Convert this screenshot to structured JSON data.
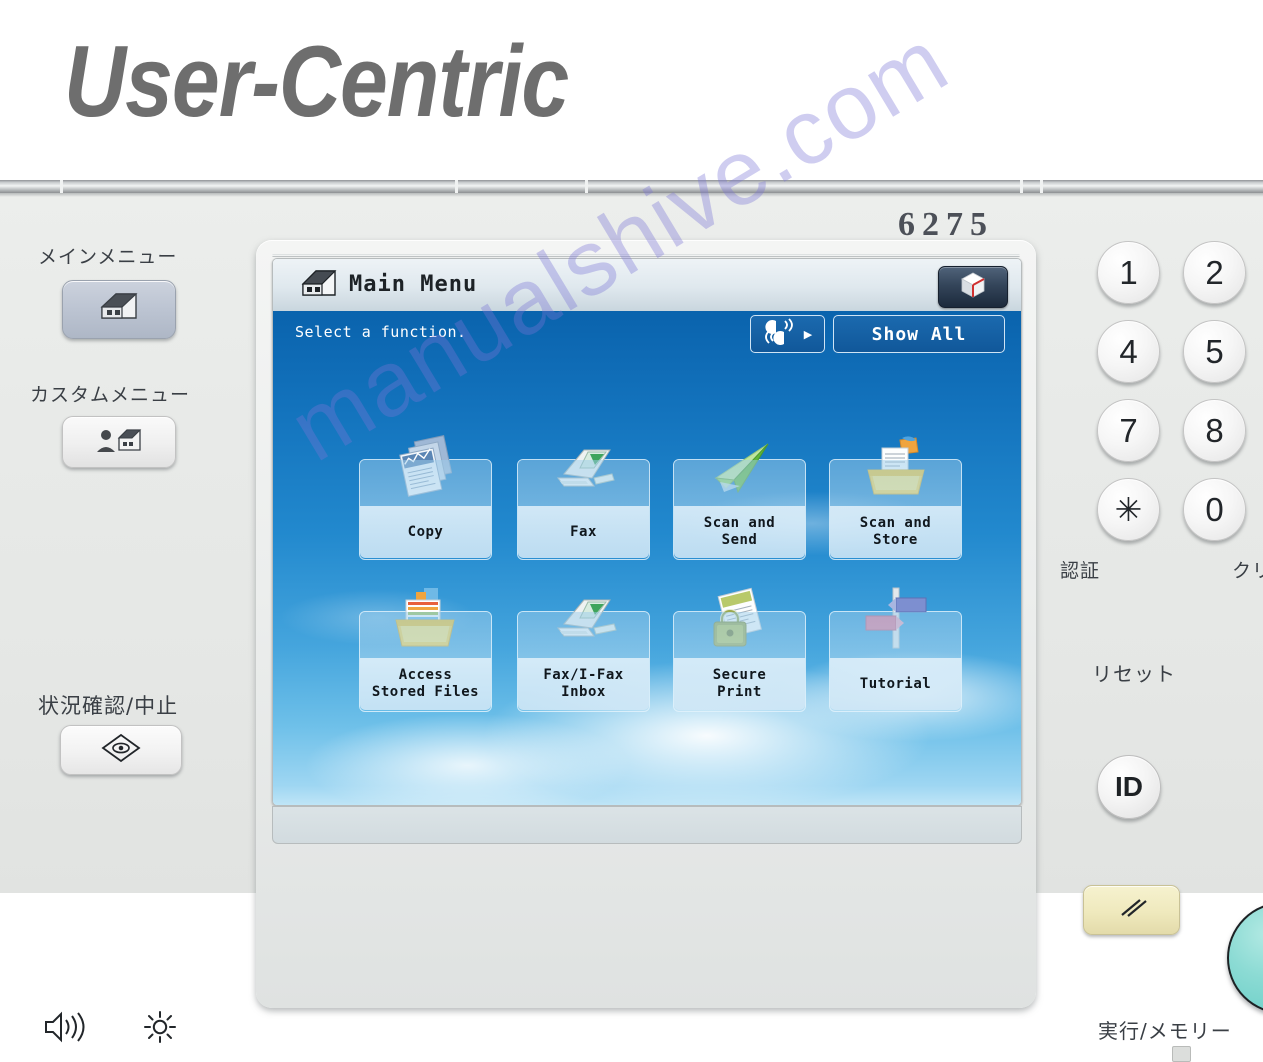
{
  "header": {
    "title": "User-Centric"
  },
  "panel": {
    "model_number": "6275",
    "left_controls": {
      "main_menu_label": "メインメニュー",
      "main_menu_icon": "house-icon",
      "custom_menu_label": "カスタムメニュー",
      "custom_menu_icon": "person-house-icon",
      "status_label": "状況確認/中止",
      "status_icon": "diamond-eye-icon",
      "speaker_icon": "speaker-volume-icon",
      "brightness_icon": "brightness-sun-icon"
    },
    "right_controls": {
      "keypad": [
        "1",
        "2",
        "4",
        "5",
        "7",
        "8",
        "✳",
        "0"
      ],
      "auth_label": "認証",
      "id_key_label": "ID",
      "reset_label": "リセット",
      "reset_icon": "double-slash-icon",
      "clear_label": "クリ",
      "exec_memory_label": "実行/メモリー",
      "start_button_icon": "start-circle-icon"
    }
  },
  "screen": {
    "titlebar": {
      "title": "Main Menu",
      "home_icon": "house-icon",
      "cube_button_icon": "3d-cube-icon"
    },
    "hint": "Select a function.",
    "voice_button_icon": "voice-guidance-icon",
    "voice_button_arrow": "▶",
    "show_all_label": "Show All",
    "tiles": [
      {
        "label": "Copy",
        "icon": "documents-stack-icon",
        "line1": "Copy",
        "line2": ""
      },
      {
        "label": "Fax",
        "icon": "fax-machine-icon",
        "line1": "Fax",
        "line2": ""
      },
      {
        "label": "Scan and Send",
        "icon": "paper-plane-icon",
        "line1": "Scan and",
        "line2": "Send"
      },
      {
        "label": "Scan and Store",
        "icon": "inbox-tray-bird-icon",
        "line1": "Scan and",
        "line2": "Store"
      },
      {
        "label": "Access Stored Files",
        "icon": "file-drawer-icon",
        "line1": "Access",
        "line2": "Stored Files"
      },
      {
        "label": "Fax/I-Fax Inbox",
        "icon": "fax-inbox-icon",
        "line1": "Fax/I-Fax",
        "line2": "Inbox"
      },
      {
        "label": "Secure Print",
        "icon": "padlock-document-icon",
        "line1": "Secure",
        "line2": "Print"
      },
      {
        "label": "Tutorial",
        "icon": "signpost-icon",
        "line1": "Tutorial",
        "line2": ""
      }
    ]
  },
  "watermark": {
    "text": "manualshive.com"
  },
  "colors": {
    "header_text": "#6e6e6e",
    "panel_body": "#e8eae8",
    "lcd_sky_top": "#0a63ad",
    "lcd_sky_bottom": "#bfe5f7",
    "titlebar": "#dfe8ee",
    "reset_key": "#efe9bd",
    "start_key": "#8cdbd4",
    "watermark": "#7b74d6"
  }
}
